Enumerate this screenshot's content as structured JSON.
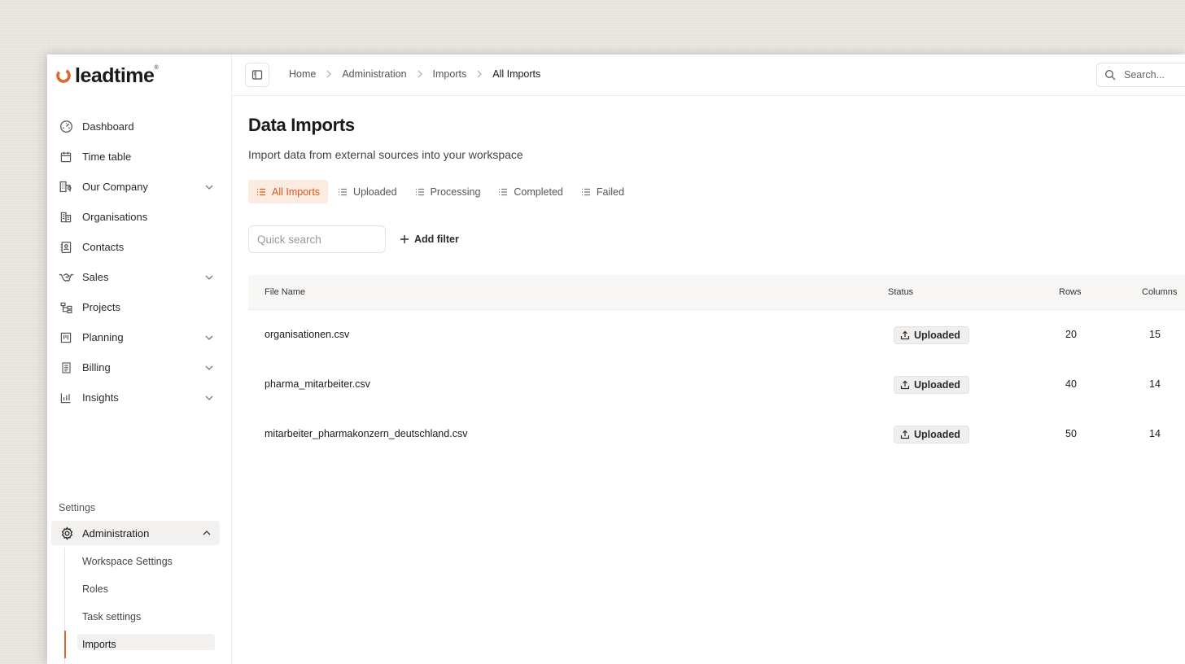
{
  "brand": {
    "name": "leadtime",
    "mark": "®",
    "accent": "#e0662c"
  },
  "sidebar": {
    "items": [
      {
        "label": "Dashboard",
        "icon": "gauge-icon",
        "has_chevron": false
      },
      {
        "label": "Time table",
        "icon": "calendar-icon",
        "has_chevron": false
      },
      {
        "label": "Our Company",
        "icon": "company-icon",
        "has_chevron": true
      },
      {
        "label": "Organisations",
        "icon": "building-icon",
        "has_chevron": false
      },
      {
        "label": "Contacts",
        "icon": "contact-card-icon",
        "has_chevron": false
      },
      {
        "label": "Sales",
        "icon": "handshake-icon",
        "has_chevron": true
      },
      {
        "label": "Projects",
        "icon": "hierarchy-icon",
        "has_chevron": false
      },
      {
        "label": "Planning",
        "icon": "kanban-icon",
        "has_chevron": true
      },
      {
        "label": "Billing",
        "icon": "receipt-icon",
        "has_chevron": true
      },
      {
        "label": "Insights",
        "icon": "bar-chart-icon",
        "has_chevron": true
      }
    ],
    "settings_label": "Settings",
    "admin": {
      "label": "Administration",
      "icon": "gear-icon"
    },
    "sub_items": [
      {
        "label": "Workspace Settings",
        "active": false
      },
      {
        "label": "Roles",
        "active": false
      },
      {
        "label": "Task settings",
        "active": false
      },
      {
        "label": "Imports",
        "active": true
      }
    ]
  },
  "topbar": {
    "breadcrumb": [
      "Home",
      "Administration",
      "Imports",
      "All Imports"
    ],
    "search_placeholder": "Search..."
  },
  "page": {
    "title": "Data Imports",
    "subtitle": "Import data from external sources into your workspace"
  },
  "tabs": [
    {
      "label": "All Imports",
      "active": true
    },
    {
      "label": "Uploaded",
      "active": false
    },
    {
      "label": "Processing",
      "active": false
    },
    {
      "label": "Completed",
      "active": false
    },
    {
      "label": "Failed",
      "active": false
    }
  ],
  "filters": {
    "quick_search_placeholder": "Quick search",
    "add_filter_label": "Add filter"
  },
  "table": {
    "columns": [
      "File Name",
      "Status",
      "Rows",
      "Columns"
    ],
    "rows": [
      {
        "file": "organisationen.csv",
        "status": "Uploaded",
        "rows": "20",
        "columns": "15"
      },
      {
        "file": "pharma_mitarbeiter.csv",
        "status": "Uploaded",
        "rows": "40",
        "columns": "14"
      },
      {
        "file": "mitarbeiter_pharmakonzern_deutschland.csv",
        "status": "Uploaded",
        "rows": "50",
        "columns": "14"
      }
    ]
  }
}
